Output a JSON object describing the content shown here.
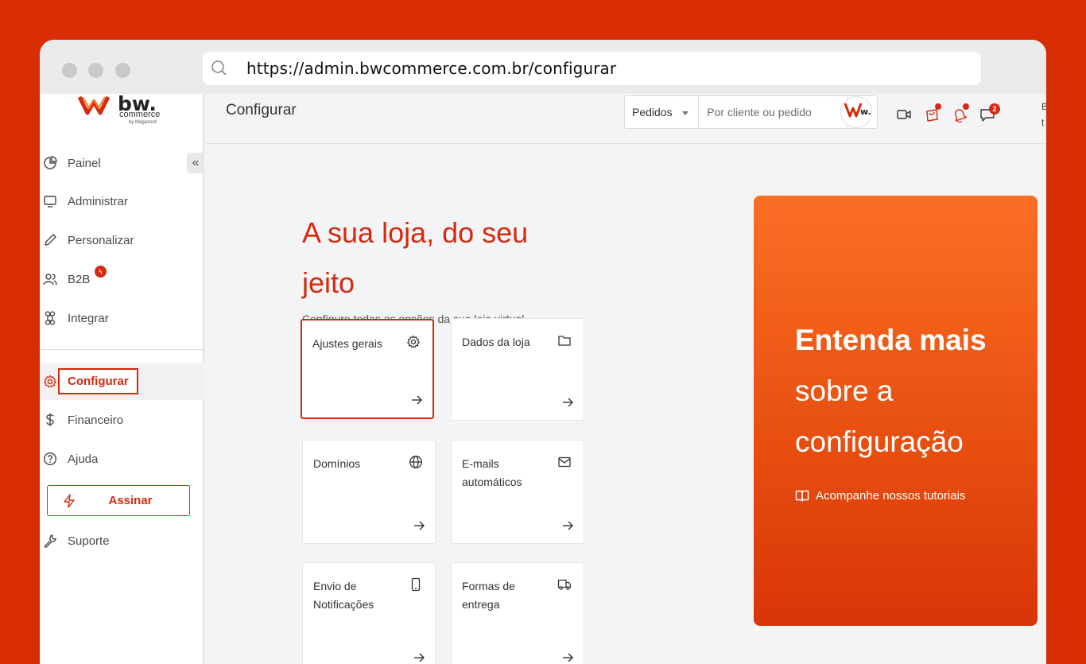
{
  "browser": {
    "url": "https://admin.bwcommerce.com.br/configurar"
  },
  "brand": {
    "logo_text": "bw.",
    "logo_sub": "commerce",
    "logo_by": "by Magazord"
  },
  "sidebar": {
    "collapse_icon": "chevrons-left-icon",
    "items": [
      {
        "label": "Painel",
        "icon": "pie-chart-icon"
      },
      {
        "label": "Administrar",
        "icon": "monitor-icon"
      },
      {
        "label": "Personalizar",
        "icon": "pencil-icon"
      },
      {
        "label": "B2B",
        "icon": "users-icon"
      },
      {
        "label": "Integrar",
        "icon": "command-icon"
      },
      {
        "label": "Configurar",
        "icon": "gear-icon"
      },
      {
        "label": "Financeiro",
        "icon": "dollar-icon"
      },
      {
        "label": "Ajuda",
        "icon": "help-circle-icon"
      }
    ],
    "subscribe_label": "Assinar",
    "support_label": "Suporte"
  },
  "header": {
    "title": "Configurar",
    "search_scope": "Pedidos",
    "search_placeholder": "Por cliente ou pedido",
    "messages_count": "2",
    "user_name": "B t"
  },
  "main": {
    "hero_title": "A sua loja, do seu jeito",
    "hero_subtitle": "Configure todas as opções da sua loja virtual.",
    "cards": [
      {
        "label": "Ajustes gerais",
        "icon": "gear-icon"
      },
      {
        "label": "Dados da loja",
        "icon": "folder-icon"
      },
      {
        "label": "Domínios",
        "icon": "globe-icon"
      },
      {
        "label": "E-mails automáticos",
        "icon": "mail-icon"
      },
      {
        "label": "Envio de Notificações",
        "icon": "smartphone-icon"
      },
      {
        "label": "Formas de entrega",
        "icon": "truck-icon"
      }
    ]
  },
  "promo": {
    "title_bold": "Entenda mais",
    "title_rest": "sobre a configuração",
    "link_label": "Acompanhe nossos tutoriais"
  },
  "colors": {
    "accent": "#d42a0e",
    "background": "#d92e05"
  }
}
